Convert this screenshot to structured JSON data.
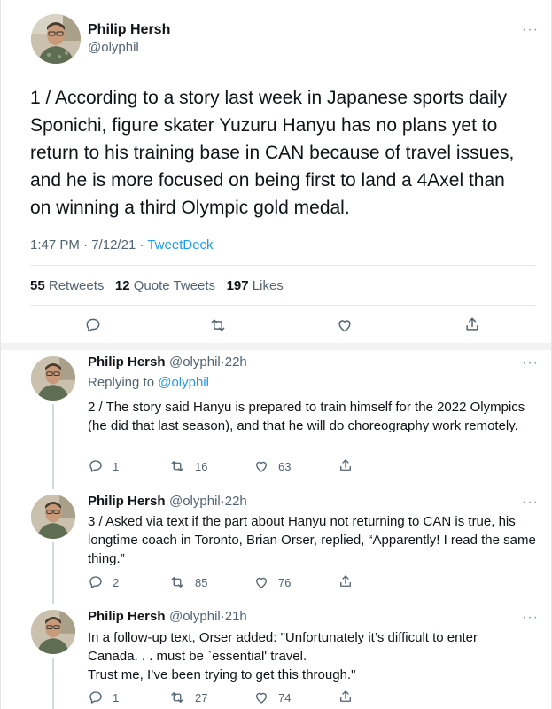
{
  "main_tweet": {
    "author_name": "Philip Hersh",
    "author_handle": "@olyphil",
    "text": "1 / According to a story last week in Japanese sports daily Sponichi, figure skater Yuzuru Hanyu has no plans yet to return to his training base in CAN because of travel issues, and he is more focused on being first to land a 4Axel than on winning a third Olympic gold medal.",
    "time": "1:47 PM",
    "date": "7/12/21",
    "source": "TweetDeck",
    "retweets_count": "55",
    "retweets_label": "Retweets",
    "quotes_count": "12",
    "quotes_label": "Quote Tweets",
    "likes_count": "197",
    "likes_label": "Likes",
    "more_icon": "more-dots-icon"
  },
  "replies": [
    {
      "author_name": "Philip Hersh",
      "author_handle": "@olyphil",
      "age": "22h",
      "replying_prefix": "Replying to",
      "replying_handle": "@olyphil",
      "text": "2 / The story said Hanyu is prepared to train himself for the 2022 Olympics (he did that last season), and that he will do choreography work remotely.",
      "reply_count": "1",
      "retweet_count": "16",
      "like_count": "63"
    },
    {
      "author_name": "Philip Hersh",
      "author_handle": "@olyphil",
      "age": "22h",
      "text": "3 / Asked via text if the part about Hanyu not returning to CAN is true, his longtime coach in Toronto, Brian Orser, replied, “Apparently!  I read the same thing.”",
      "reply_count": "2",
      "retweet_count": "85",
      "like_count": "76"
    },
    {
      "author_name": "Philip Hersh",
      "author_handle": "@olyphil",
      "age": "21h",
      "text_line1": "In a follow-up text, Orser added:  \"Unfortunately it’s difficult to enter",
      "text_line2": "Canada. . . must be `essential' travel.",
      "text_line3": "Trust me, I’ve been trying to get this through.\"",
      "reply_count": "1",
      "retweet_count": "27",
      "like_count": "74"
    }
  ],
  "separator_dot": "·",
  "colors": {
    "link": "#1d9bf0",
    "muted": "#536471",
    "text": "#0f1419"
  }
}
